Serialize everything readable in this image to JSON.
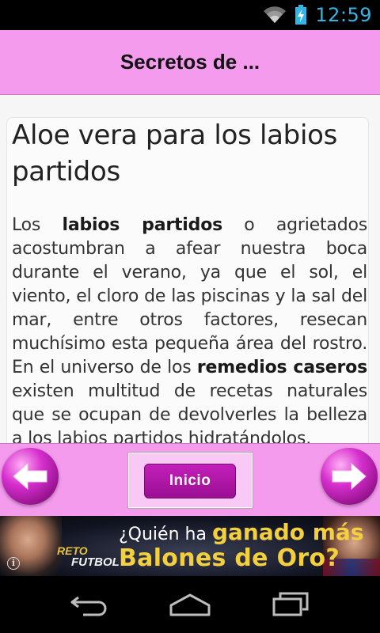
{
  "status_bar": {
    "time": "12:59",
    "icons": [
      "wifi-icon",
      "battery-charging-icon"
    ],
    "accent_color": "#33b5e5"
  },
  "header": {
    "title": "Secretos de ...",
    "background_color": "#f49bee"
  },
  "article": {
    "title": "Aloe vera para los labios partidos",
    "body_segments": [
      {
        "text": "Los ",
        "bold": false
      },
      {
        "text": "labios partidos",
        "bold": true
      },
      {
        "text": " o agrietados acostumbran a afear nuestra boca durante el verano, ya que el sol, el viento, el cloro de las piscinas y la sal del mar, entre otros factores, resecan muchísimo esta pequeña área del rostro. En el universo de los ",
        "bold": false
      },
      {
        "text": "remedios caseros",
        "bold": true
      },
      {
        "text": " existen multitud de recetas naturales que se ocupan de devolverles la belleza a los labios partidos hidratándolos.",
        "bold": false
      }
    ]
  },
  "navigation": {
    "prev_icon": "arrow-left-icon",
    "next_icon": "arrow-right-icon",
    "home_label": "Inicio",
    "button_color": "#b116a9"
  },
  "ad": {
    "logo_top": "RETO",
    "logo_bottom": "FUTBOL",
    "line1_small": "¿Quién ha ",
    "line1_big": "ganado más",
    "line2": "Balones de Oro?",
    "info_icon": "i"
  },
  "system_nav": {
    "icons": [
      "back-icon",
      "home-icon",
      "recent-apps-icon"
    ]
  }
}
